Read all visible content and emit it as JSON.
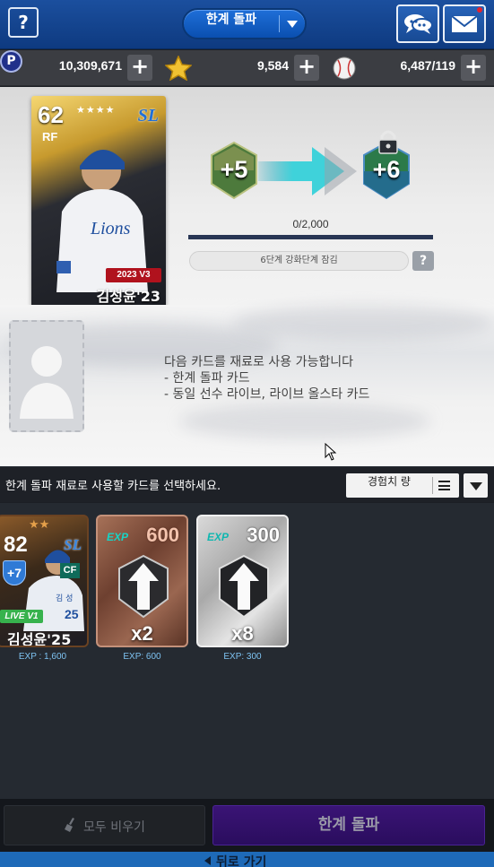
{
  "header": {
    "help_label": "?",
    "mode_label": "한계 돌파"
  },
  "currency": {
    "points_icon_label": "P",
    "points": "10,309,671",
    "stars": "9,584",
    "balls": "6,487/119",
    "plus_label": "+"
  },
  "upgrade": {
    "card": {
      "ovr": "62",
      "position": "RF",
      "stars": "★★★★",
      "team": "SL",
      "badge": "2023 V3",
      "name": "김성윤'23"
    },
    "current_level": "+5",
    "next_level": "+6",
    "progress_text": "0/2,000",
    "progress_fraction": 0,
    "lock_notice": "6단계 강화단계 잠김",
    "info_label": "?"
  },
  "materials": {
    "hint_lines": [
      "다음 카드를 재료로 사용 가능합니다",
      "- 한계 돌파 카드",
      "- 동일 선수 라이브, 라이브 올스타 카드"
    ]
  },
  "list": {
    "title": "한계 돌파 재료로 사용할 카드를 선택하세요.",
    "sort_label": "경험치 량",
    "items": [
      {
        "ovr": "82",
        "stars": "★★",
        "plus": "+7",
        "team": "SL",
        "position": "CF",
        "badge": "LIVE V1",
        "name": "김성윤'25",
        "exp_label": "EXP : 1,600"
      },
      {
        "tag": "EXP",
        "exp_value": "600",
        "multiplier": "x2",
        "exp_label": "EXP: 600"
      },
      {
        "tag": "EXP",
        "exp_value": "300",
        "multiplier": "x8",
        "exp_label": "EXP: 300"
      }
    ]
  },
  "buttons": {
    "clear": "모두 비우기",
    "confirm": "한계 돌파",
    "back": "뒤로 가기"
  },
  "colors": {
    "header_blue": "#1b4f9e",
    "confirm_purple": "#3a1475",
    "exp_text": "#7ec3f2"
  }
}
